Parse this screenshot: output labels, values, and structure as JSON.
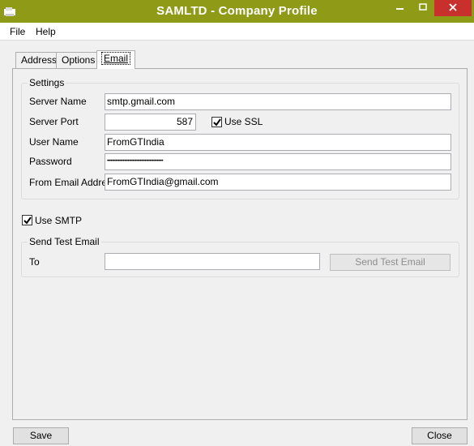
{
  "window": {
    "title": "SAMLTD - Company Profile"
  },
  "menu": {
    "file": "File",
    "help": "Help"
  },
  "tabs": [
    {
      "label": "Address"
    },
    {
      "label": "Options"
    },
    {
      "label": "Email",
      "active": true
    }
  ],
  "settings": {
    "group_title": "Settings",
    "server_name_label": "Server Name",
    "server_name_value": "smtp.gmail.com",
    "server_port_label": "Server Port",
    "server_port_value": "587",
    "use_ssl_label": "Use SSL",
    "use_ssl_checked": true,
    "user_name_label": "User Name",
    "user_name_value": "FromGTIndia",
    "password_label": "Password",
    "password_value": "••••••••••••••••••••••••••••••••••••••••••••••",
    "from_email_label": "From Email Address",
    "from_email_value": "FromGTIndia@gmail.com"
  },
  "use_smtp": {
    "label": "Use SMTP",
    "checked": true
  },
  "send_test": {
    "group_title": "Send Test Email",
    "to_label": "To",
    "to_value": "",
    "button_label": "Send Test Email"
  },
  "footer": {
    "save_label": "Save",
    "close_label": "Close"
  },
  "colors": {
    "titlebar": "#8f9a16",
    "close_button": "#c7302d"
  },
  "icons": {
    "minimize": "minimize-icon",
    "maximize": "maximize-icon",
    "close": "close-icon",
    "app": "app-icon"
  }
}
